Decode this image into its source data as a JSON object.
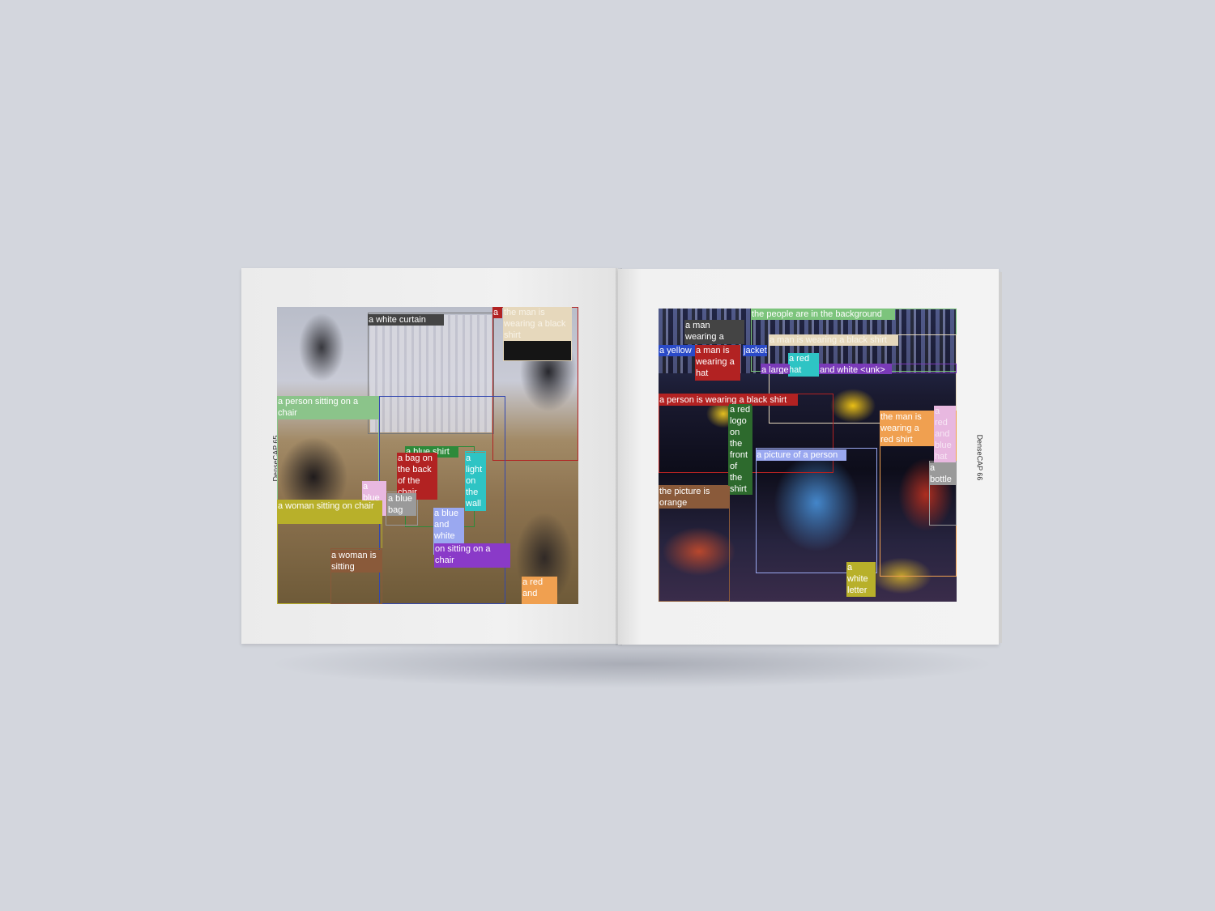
{
  "folios": {
    "left": "DenseCAP 65",
    "right": "DenseCAP 66"
  },
  "left_captions": [
    {
      "text": "a white curtain",
      "color": "#444444"
    },
    {
      "text": "a",
      "color": "#b22222"
    },
    {
      "text": "the man is wearing a black shirt",
      "color": "#e6d8bc"
    },
    {
      "text": "a person sitting on a chair",
      "color": "#8bc48a"
    },
    {
      "text": "a blue shirt",
      "color": "#2d8a3a"
    },
    {
      "text": "a bag on the back of the chair",
      "color": "#b22222"
    },
    {
      "text": "a light on the wall",
      "color": "#2ec4c4"
    },
    {
      "text": "a blue bag",
      "color": "#e8b8e0"
    },
    {
      "text": "a blue bag",
      "color": "#9a9a9a"
    },
    {
      "text": "a woman sitting on chair",
      "color": "#b8b02a"
    },
    {
      "text": "a blue and white shoe",
      "color": "#9aa8f0"
    },
    {
      "text": "on sitting on a chair",
      "color": "#8a3ac8"
    },
    {
      "text": "a woman is sitting",
      "color": "#8a5a3a"
    },
    {
      "text": "a red and",
      "color": "#f0a050"
    }
  ],
  "right_captions": [
    {
      "text": "the people are in the background",
      "color": "#7cc47c"
    },
    {
      "text": "a man wearing a",
      "color": "#444444"
    },
    {
      "text": "a yellow",
      "color": "#2a4ac8"
    },
    {
      "text": "a man is wearing a hat",
      "color": "#b22222"
    },
    {
      "text": "jacket",
      "color": "#2a4ac8"
    },
    {
      "text": "a man is wearing a black shirt",
      "color": "#e6d8bc"
    },
    {
      "text": "a red hat",
      "color": "#2ec4c4"
    },
    {
      "text": "a large",
      "color": "#7a3ab8"
    },
    {
      "text": "and white <unk>",
      "color": "#7a3ab8"
    },
    {
      "text": "a person is wearing a black shirt",
      "color": "#b22222"
    },
    {
      "text": "a red logo on the front of the shirt",
      "color": "#2d6a2d"
    },
    {
      "text": "the man is wearing a red shirt",
      "color": "#f0a050"
    },
    {
      "text": "a red and blue hat",
      "color": "#e8b8e0"
    },
    {
      "text": "a picture of a person",
      "color": "#9aa8f0"
    },
    {
      "text": "a bottle",
      "color": "#9a9a9a"
    },
    {
      "text": "the picture is orange",
      "color": "#8a5a3a"
    },
    {
      "text": "a white letter",
      "color": "#b8b02a"
    }
  ]
}
